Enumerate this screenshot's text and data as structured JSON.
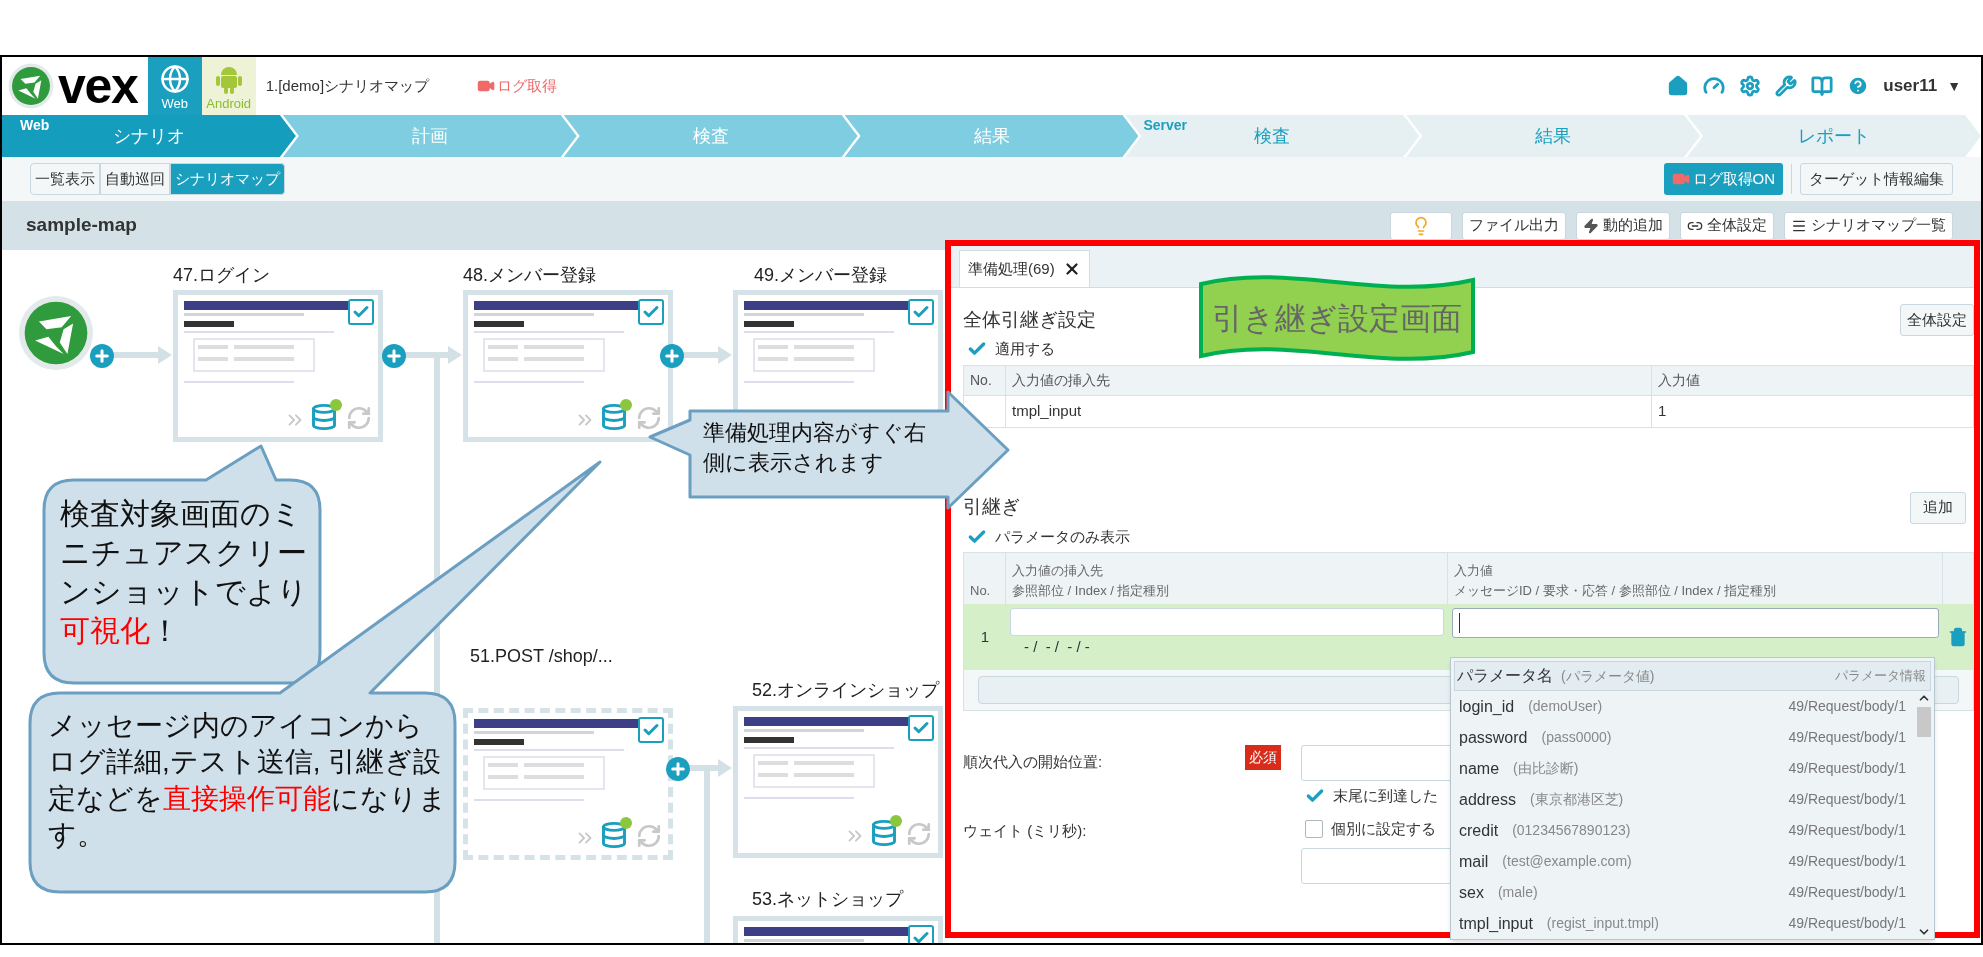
{
  "header": {
    "logo_text": "vex",
    "platform_tabs": [
      {
        "label": "Web",
        "kind": "web",
        "selected": true
      },
      {
        "label": "Android",
        "kind": "android",
        "selected": false
      }
    ],
    "scenario_title": "1.[demo]シナリオマップ",
    "log_link": "ログ取得",
    "user_name": "user11",
    "user_caret": "▼"
  },
  "steps": [
    {
      "label": "シナリオ",
      "kind": "web",
      "selected": true,
      "tag": "Web"
    },
    {
      "label": "計画",
      "kind": "web",
      "selected": false
    },
    {
      "label": "検査",
      "kind": "web",
      "selected": false
    },
    {
      "label": "結果",
      "kind": "web",
      "selected": false
    },
    {
      "label": "検査",
      "kind": "server",
      "selected": false,
      "tag": "Server"
    },
    {
      "label": "結果",
      "kind": "server",
      "selected": false
    },
    {
      "label": "レポート",
      "kind": "server",
      "selected": false
    }
  ],
  "view_modes": [
    {
      "label": "一覧表示",
      "selected": false
    },
    {
      "label": "自動巡回",
      "selected": false
    },
    {
      "label": "シナリオマップ",
      "selected": true
    }
  ],
  "log_button": "ログ取得ON",
  "target_button": "ターゲット情報編集",
  "map": {
    "title": "sample-map",
    "actions": [
      {
        "kind": "hint"
      },
      {
        "kind": "export",
        "label": "ファイル出力"
      },
      {
        "kind": "dynamic",
        "label": "動的追加"
      },
      {
        "kind": "settings",
        "label": "全体設定"
      },
      {
        "kind": "list",
        "label": "シナリオマップ一覧"
      }
    ],
    "nodes": [
      {
        "title": "47.ログイン",
        "checked": true,
        "dashed": false
      },
      {
        "title": "48.メンバー登録",
        "checked": true,
        "dashed": false
      },
      {
        "title": "49.メンバー登録",
        "checked": true,
        "dashed": false
      },
      {
        "title": "51.POST /shop/...",
        "checked": true,
        "dashed": true
      },
      {
        "title": "52.オンラインショップ",
        "checked": true,
        "dashed": false
      },
      {
        "title": "53.ネットショップ",
        "checked": true,
        "dashed": false
      }
    ]
  },
  "panel": {
    "tab_label": "準備処理(69)",
    "global": {
      "title": "全体引継ぎ設定",
      "button": "全体設定",
      "apply": {
        "label": "適用する",
        "checked": true
      },
      "columns": [
        "No.",
        "入力値の挿入先",
        "入力値"
      ],
      "rows": [
        {
          "target": "tmpl_input",
          "value": "1"
        }
      ]
    },
    "inherit": {
      "title": "引継ぎ",
      "button": "追加",
      "params_only": {
        "label": "パラメータのみ表示",
        "checked": true
      },
      "columns": [
        {
          "title": "No."
        },
        {
          "title": "入力値の挿入先",
          "sub": "参照部位 /  Index / 指定種別"
        },
        {
          "title": "入力値",
          "sub": "メッセージID /  要求・応答 /  参照部位 /  Index /  指定種別"
        }
      ],
      "rows": [
        {
          "no": "1",
          "detail": "- /  - /  - / -",
          "selected": true
        }
      ]
    },
    "form": {
      "start_label": "順次代入の開始位置:",
      "required_badge": "必須",
      "wrap": {
        "label": "末尾に到達した",
        "checked": true
      },
      "wait_label": "ウェイト (ミリ秒):",
      "individual": {
        "label": "個別に設定する",
        "checked": false
      }
    },
    "dropdown": {
      "header": {
        "name": "パラメータ名",
        "value": "(パラメータ値)",
        "info": "パラメータ情報"
      },
      "items": [
        {
          "name": "login_id",
          "value": "(demoUser)",
          "info": "49/Request/body/1"
        },
        {
          "name": "password",
          "value": "(pass0000)",
          "info": "49/Request/body/1"
        },
        {
          "name": "name",
          "value": "(由比診断)",
          "info": "49/Request/body/1"
        },
        {
          "name": "address",
          "value": "(東京都港区芝)",
          "info": "49/Request/body/1"
        },
        {
          "name": "credit",
          "value": "(01234567890123)",
          "info": "49/Request/body/1"
        },
        {
          "name": "mail",
          "value": "(test@example.com)",
          "info": "49/Request/body/1"
        },
        {
          "name": "sex",
          "value": "(male)",
          "info": "49/Request/body/1"
        },
        {
          "name": "tmpl_input",
          "value": "(regist_input.tmpl)",
          "info": "49/Request/body/1"
        }
      ]
    }
  },
  "annotations": {
    "callouts": [
      {
        "kind": "bubble",
        "segments": [
          {
            "text": "検査対象画面のミニチュアスクリーンショットでより",
            "emphasis": false
          },
          {
            "text": "可視化",
            "emphasis": true
          },
          {
            "text": "！",
            "emphasis": false
          }
        ]
      },
      {
        "kind": "bubble",
        "segments": [
          {
            "text": "メッセージ内のアイコンからログ詳細,テスト送信, 引継ぎ設定などを",
            "emphasis": false
          },
          {
            "text": "直接操作可能",
            "emphasis": true
          },
          {
            "text": "になります。",
            "emphasis": false
          }
        ]
      },
      {
        "kind": "arrow",
        "segments": [
          {
            "text": "準備処理内容がすぐ右側に表示されます",
            "emphasis": false
          }
        ]
      }
    ],
    "banner": "引き継ぎ設定画面"
  }
}
